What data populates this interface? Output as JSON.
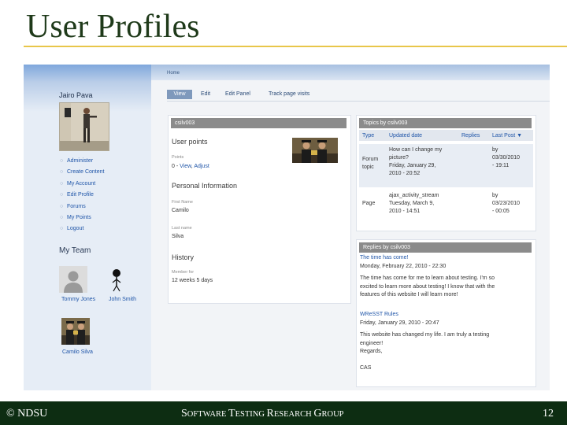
{
  "slide": {
    "title": "User Profiles",
    "footer_left": "© NDSU",
    "footer_center_parts": [
      {
        "big": "S",
        "small": "OFTWARE "
      },
      {
        "big": "T",
        "small": "ESTING "
      },
      {
        "big": "R",
        "small": "ESEARCH "
      },
      {
        "big": "G",
        "small": "ROUP"
      }
    ],
    "page_number": "12"
  },
  "sidebar": {
    "user_name": "Jairo Pava",
    "menu": [
      "Administer",
      "Create Content",
      "My Account",
      "Edit Profile",
      "Forums",
      "My Points",
      "Logout"
    ],
    "team_title": "My Team",
    "team": [
      {
        "name": "Tommy Jones",
        "icon": "person-silhouette-icon"
      },
      {
        "name": "John Smith",
        "icon": "stick-figure-icon"
      },
      {
        "name": "Camilo Silva",
        "icon": "graduates-photo"
      }
    ]
  },
  "main": {
    "breadcrumb": "Home",
    "tabs": [
      "View",
      "Edit",
      "Edit Panel",
      "Track page visits"
    ],
    "profile_panel": {
      "header": "csilv003",
      "points_title": "User points",
      "points_label": "Points",
      "points_value_prefix": "0 - ",
      "points_view_link": "View",
      "points_sep": ", ",
      "points_adjust_link": "Adjust",
      "personal_title": "Personal Information",
      "first_name_label": "First Name",
      "first_name": "Camilo",
      "last_name_label": "Last name",
      "last_name": "Silva",
      "history_title": "History",
      "member_for_label": "Member for",
      "member_for": "12 weeks 5 days"
    },
    "topics_panel": {
      "header": "Topics by csilv003",
      "columns": [
        "Type",
        "Updated date",
        "Replies",
        "Last Post"
      ],
      "sort_indicator": "▼",
      "rows": [
        {
          "type": [
            "Forum",
            "topic"
          ],
          "title": [
            "How can I change my",
            "picture?"
          ],
          "date": [
            "Friday, January 29,",
            "2010 - 20:52"
          ],
          "replies": "",
          "last_post": [
            "by",
            "03/30/2010",
            "- 19:11"
          ]
        },
        {
          "type": [
            "Page"
          ],
          "title": [
            "ajax_activity_stream"
          ],
          "date": [
            "Tuesday, March 9,",
            "2010 - 14:51"
          ],
          "replies": "",
          "last_post": [
            "by",
            "03/23/2010",
            "- 00:05"
          ]
        }
      ]
    },
    "replies_panel": {
      "header": "Replies by csilv003",
      "posts": [
        {
          "title": "The time has come!",
          "date": "Monday, February 22, 2010 - 22:30",
          "body": [
            "The time has come for me to learn about testing. I'm so",
            "excited to learn more about testing! I know that with the",
            "features of this website I will learn more!"
          ]
        },
        {
          "title": "WReSST Rules",
          "date": "Friday, January 29, 2010 - 20:47",
          "body": [
            "This website has changed my life. I am truly a testing",
            "engineer!",
            "Regards,",
            "",
            "CAS"
          ]
        }
      ]
    }
  },
  "colors": {
    "title": "#1f3a1a",
    "rule": "#e8c64a",
    "footer_bg": "#0d2d12",
    "link": "#1f55a8",
    "panel_header": "#8b8b8b"
  }
}
